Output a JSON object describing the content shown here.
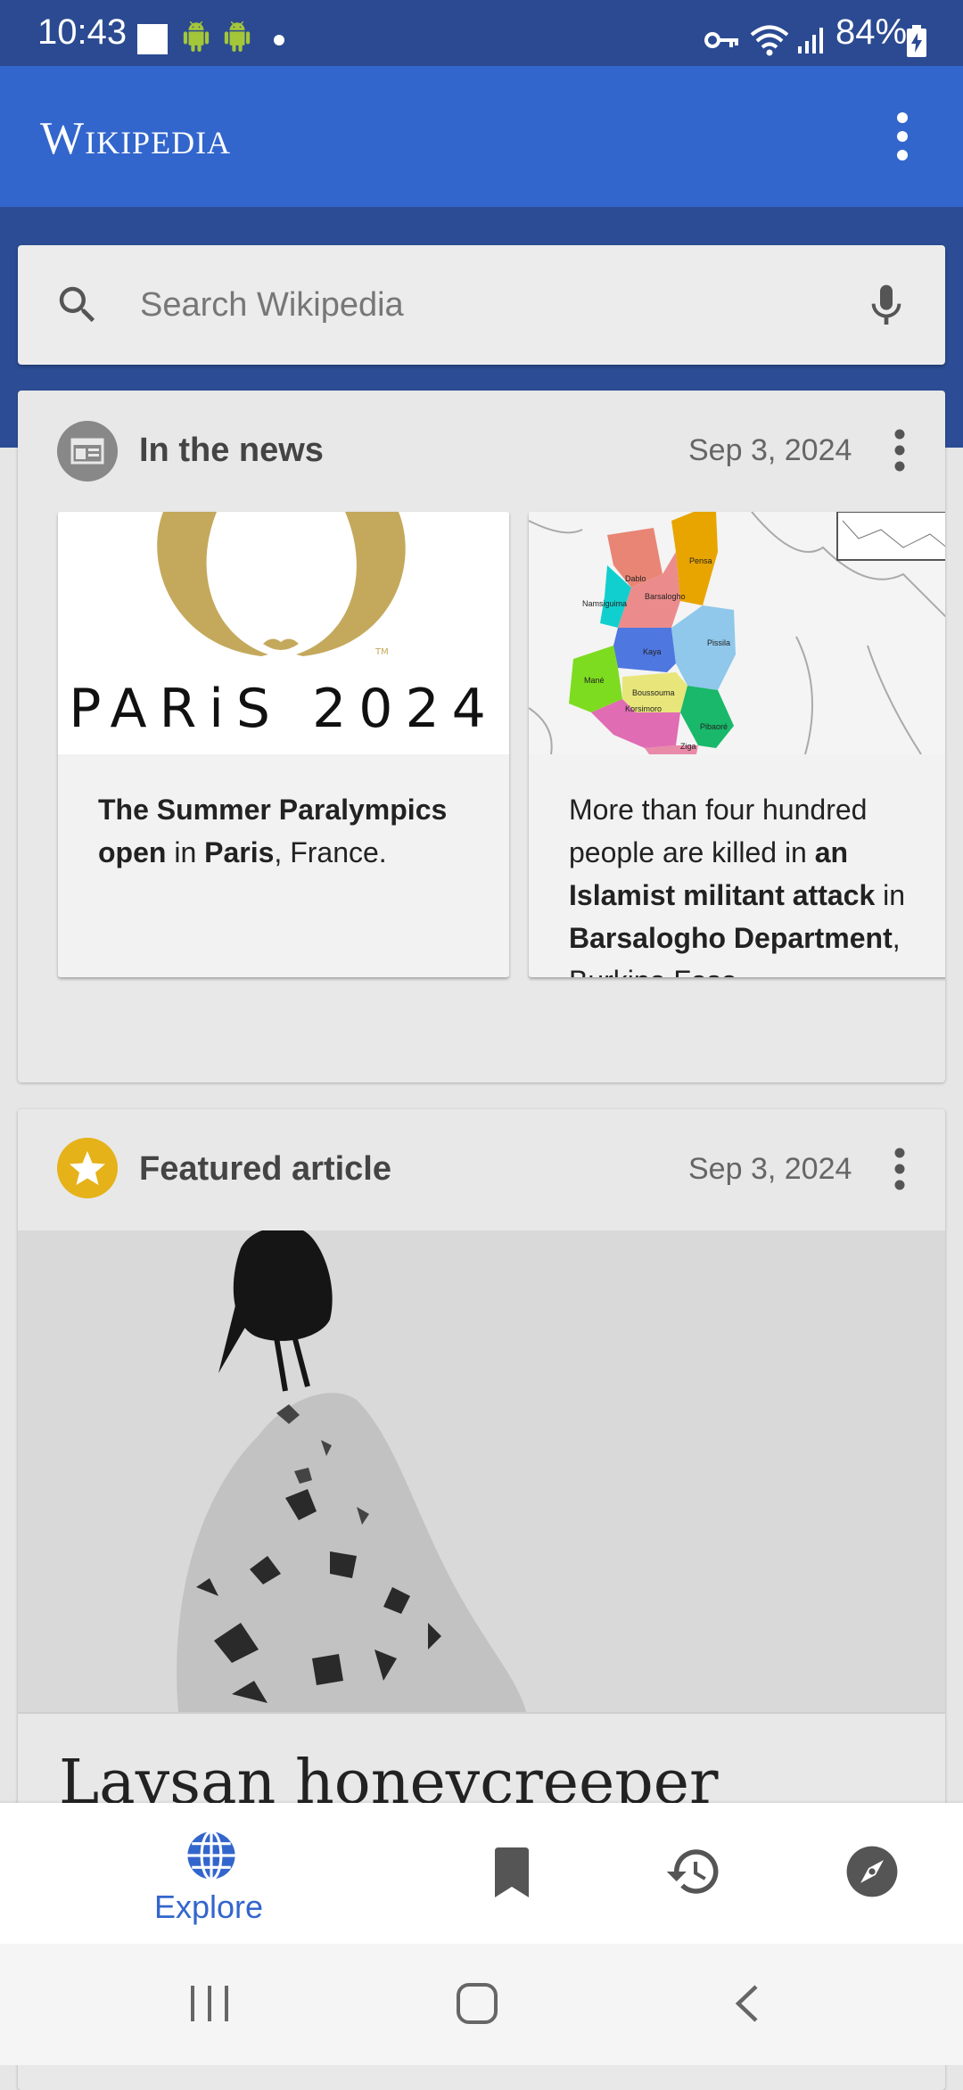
{
  "status_bar": {
    "time": "10:43",
    "battery": "84%"
  },
  "app_bar": {
    "logo_text": "Wikipedia"
  },
  "search": {
    "placeholder": "Search Wikipedia"
  },
  "news_card": {
    "title": "In the news",
    "date": "Sep 3, 2024",
    "items": [
      {
        "image_logo_text": "PARiS 2024",
        "text_parts": [
          "The Summer Paralympics open",
          " in ",
          "Paris",
          ", France."
        ]
      },
      {
        "map_labels": [
          "Dablo",
          "Pensa",
          "Namsiguima",
          "Barsalogho",
          "Kaya",
          "Pissila",
          "Mané",
          "Boussouma",
          "Korsimoro",
          "Pibaoré",
          "Ziga"
        ],
        "text_parts": [
          "More than four hundred people are killed in ",
          "an Islamist militant attack",
          " in ",
          "Barsalogho Department",
          ", Burkina Faso."
        ]
      }
    ]
  },
  "featured_card": {
    "title": "Featured article",
    "date": "Sep 3, 2024",
    "article_title": "Laysan honeycreeper"
  },
  "bottom_nav": {
    "explore_label": "Explore",
    "active_color": "#3366cc"
  }
}
